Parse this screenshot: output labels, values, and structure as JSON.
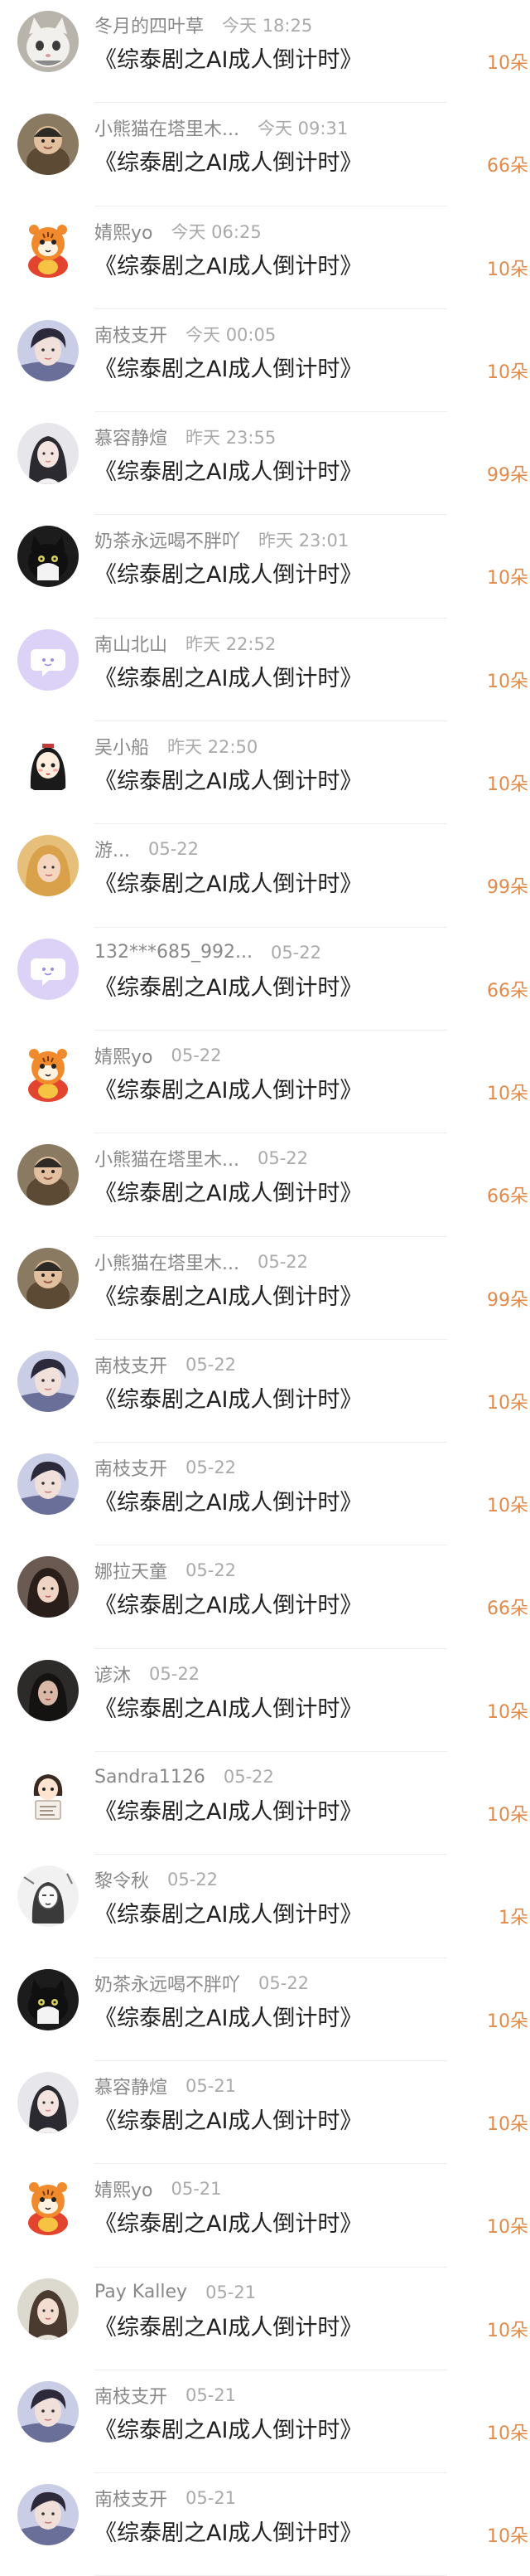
{
  "gifts": [
    {
      "name": "冬月的四叶草",
      "time": "今天 18:25",
      "title": "《综泰剧之AI成人倒计时》",
      "count": "10朵",
      "avatar": "cat-white"
    },
    {
      "name": "小熊猫在塔里木...",
      "time": "今天 09:31",
      "title": "《综泰剧之AI成人倒计时》",
      "count": "66朵",
      "avatar": "bear-child"
    },
    {
      "name": "婧熙yo",
      "time": "今天 06:25",
      "title": "《综泰剧之AI成人倒计时》",
      "count": "10朵",
      "avatar": "tiger-mascot"
    },
    {
      "name": "南枝支开",
      "time": "今天 00:05",
      "title": "《综泰剧之AI成人倒计时》",
      "count": "10朵",
      "avatar": "portrait-blue"
    },
    {
      "name": "慕容静煊",
      "time": "昨天 23:55",
      "title": "《综泰剧之AI成人倒计时》",
      "count": "99朵",
      "avatar": "girl-pale"
    },
    {
      "name": "奶茶永远喝不胖吖",
      "time": "昨天 23:01",
      "title": "《综泰剧之AI成人倒计时》",
      "count": "10朵",
      "avatar": "cat-black"
    },
    {
      "name": "南山北山",
      "time": "昨天 22:52",
      "title": "《综泰剧之AI成人倒计时》",
      "count": "10朵",
      "avatar": "default-purple"
    },
    {
      "name": "吴小船",
      "time": "昨天 22:50",
      "title": "《综泰剧之AI成人倒计时》",
      "count": "10朵",
      "avatar": "cartoon-girl"
    },
    {
      "name": "游...",
      "time": "05-22",
      "title": "《综泰剧之AI成人倒计时》",
      "count": "99朵",
      "avatar": "golden-hair"
    },
    {
      "name": "132***685_992...",
      "time": "05-22",
      "title": "《综泰剧之AI成人倒计时》",
      "count": "66朵",
      "avatar": "default-purple"
    },
    {
      "name": "婧熙yo",
      "time": "05-22",
      "title": "《综泰剧之AI成人倒计时》",
      "count": "10朵",
      "avatar": "tiger-mascot"
    },
    {
      "name": "小熊猫在塔里木...",
      "time": "05-22",
      "title": "《综泰剧之AI成人倒计时》",
      "count": "66朵",
      "avatar": "bear-child"
    },
    {
      "name": "小熊猫在塔里木...",
      "time": "05-22",
      "title": "《综泰剧之AI成人倒计时》",
      "count": "99朵",
      "avatar": "bear-child"
    },
    {
      "name": "南枝支开",
      "time": "05-22",
      "title": "《综泰剧之AI成人倒计时》",
      "count": "10朵",
      "avatar": "portrait-blue"
    },
    {
      "name": "南枝支开",
      "time": "05-22",
      "title": "《综泰剧之AI成人倒计时》",
      "count": "10朵",
      "avatar": "portrait-blue"
    },
    {
      "name": "娜拉天童",
      "time": "05-22",
      "title": "《综泰剧之AI成人倒计时》",
      "count": "66朵",
      "avatar": "portrait-dark-hair"
    },
    {
      "name": "谚沐",
      "time": "05-22",
      "title": "《综泰剧之AI成人倒计时》",
      "count": "10朵",
      "avatar": "portrait-dark"
    },
    {
      "name": "Sandra1126",
      "time": "05-22",
      "title": "《综泰剧之AI成人倒计时》",
      "count": "10朵",
      "avatar": "cartoon-sign"
    },
    {
      "name": "黎令秋",
      "time": "05-22",
      "title": "《综泰剧之AI成人倒计时》",
      "count": "1朵",
      "avatar": "sketch-figure"
    },
    {
      "name": "奶茶永远喝不胖吖",
      "time": "05-22",
      "title": "《综泰剧之AI成人倒计时》",
      "count": "10朵",
      "avatar": "cat-black"
    },
    {
      "name": "慕容静煊",
      "time": "05-21",
      "title": "《综泰剧之AI成人倒计时》",
      "count": "10朵",
      "avatar": "girl-pale"
    },
    {
      "name": "婧熙yo",
      "time": "05-21",
      "title": "《综泰剧之AI成人倒计时》",
      "count": "10朵",
      "avatar": "tiger-mascot"
    },
    {
      "name": "Pay Kalley",
      "time": "05-21",
      "title": "《综泰剧之AI成人倒计时》",
      "count": "10朵",
      "avatar": "girl-light"
    },
    {
      "name": "南枝支开",
      "time": "05-21",
      "title": "《综泰剧之AI成人倒计时》",
      "count": "10朵",
      "avatar": "portrait-blue"
    },
    {
      "name": "南枝支开",
      "time": "05-21",
      "title": "《综泰剧之AI成人倒计时》",
      "count": "10朵",
      "avatar": "portrait-blue"
    }
  ],
  "colors": {
    "count": "#e18a4a",
    "name": "#888888",
    "time": "#aaaaaa",
    "title": "#222222",
    "divider": "#eeeeee"
  }
}
